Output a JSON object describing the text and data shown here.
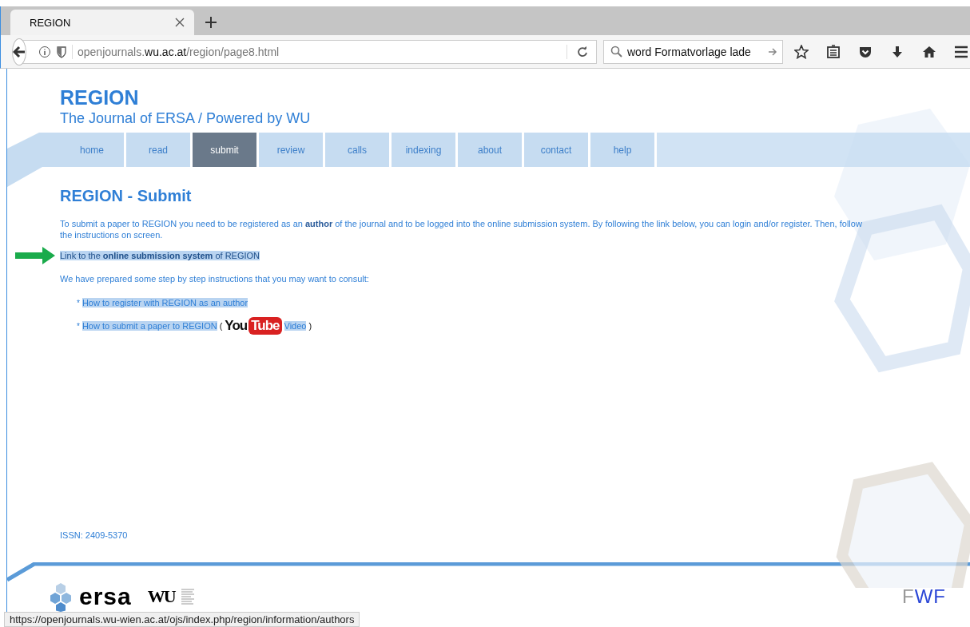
{
  "browser": {
    "tab": {
      "title": "REGION"
    },
    "address": "openjournals.**wu.ac.at**/region/page8.html",
    "search": {
      "value": "word Formatvorlage lade"
    }
  },
  "site": {
    "title": "REGION",
    "subtitle": "The Journal of ERSA / Powered by WU"
  },
  "nav": [
    {
      "label": "home",
      "selected": false
    },
    {
      "label": "read",
      "selected": false
    },
    {
      "label": "submit",
      "selected": true
    },
    {
      "label": "review",
      "selected": false
    },
    {
      "label": "calls",
      "selected": false
    },
    {
      "label": "indexing",
      "selected": false
    },
    {
      "label": "about",
      "selected": false
    },
    {
      "label": "contact",
      "selected": false
    },
    {
      "label": "help",
      "selected": false
    }
  ],
  "content": {
    "heading": "REGION - Submit",
    "intro": "To submit a paper to REGION you need to be registered as an **author** of the journal and to be logged into the online submission system. By following the link below, you can login and/or register. Then, follow the instructions on screen.",
    "submission_link": "Link to the **online submission system** of REGION",
    "instructions_intro": "We have prepared some step by step instructions that you may want to consult:",
    "instructions": [
      {
        "kind": "text",
        "bullet": "*",
        "text": "How to register with REGION as an author"
      },
      {
        "kind": "video",
        "bullet": "*",
        "text": "How to submit a paper to REGION",
        "open": "(",
        "logo_you": "You",
        "logo_tube": "Tube",
        "suffix": "Video",
        "close": ")"
      }
    ]
  },
  "footer": {
    "issn": "ISSN: 2409-5370",
    "logos": {
      "ersa": "ersa",
      "wu": "WU",
      "fwf_f1": "F",
      "fwf_w": "W",
      "fwf_f2": "F"
    }
  },
  "status_bar": {
    "url": "https://openjournals.wu-wien.ac.at/ojs/index.php/region/information/authors"
  }
}
